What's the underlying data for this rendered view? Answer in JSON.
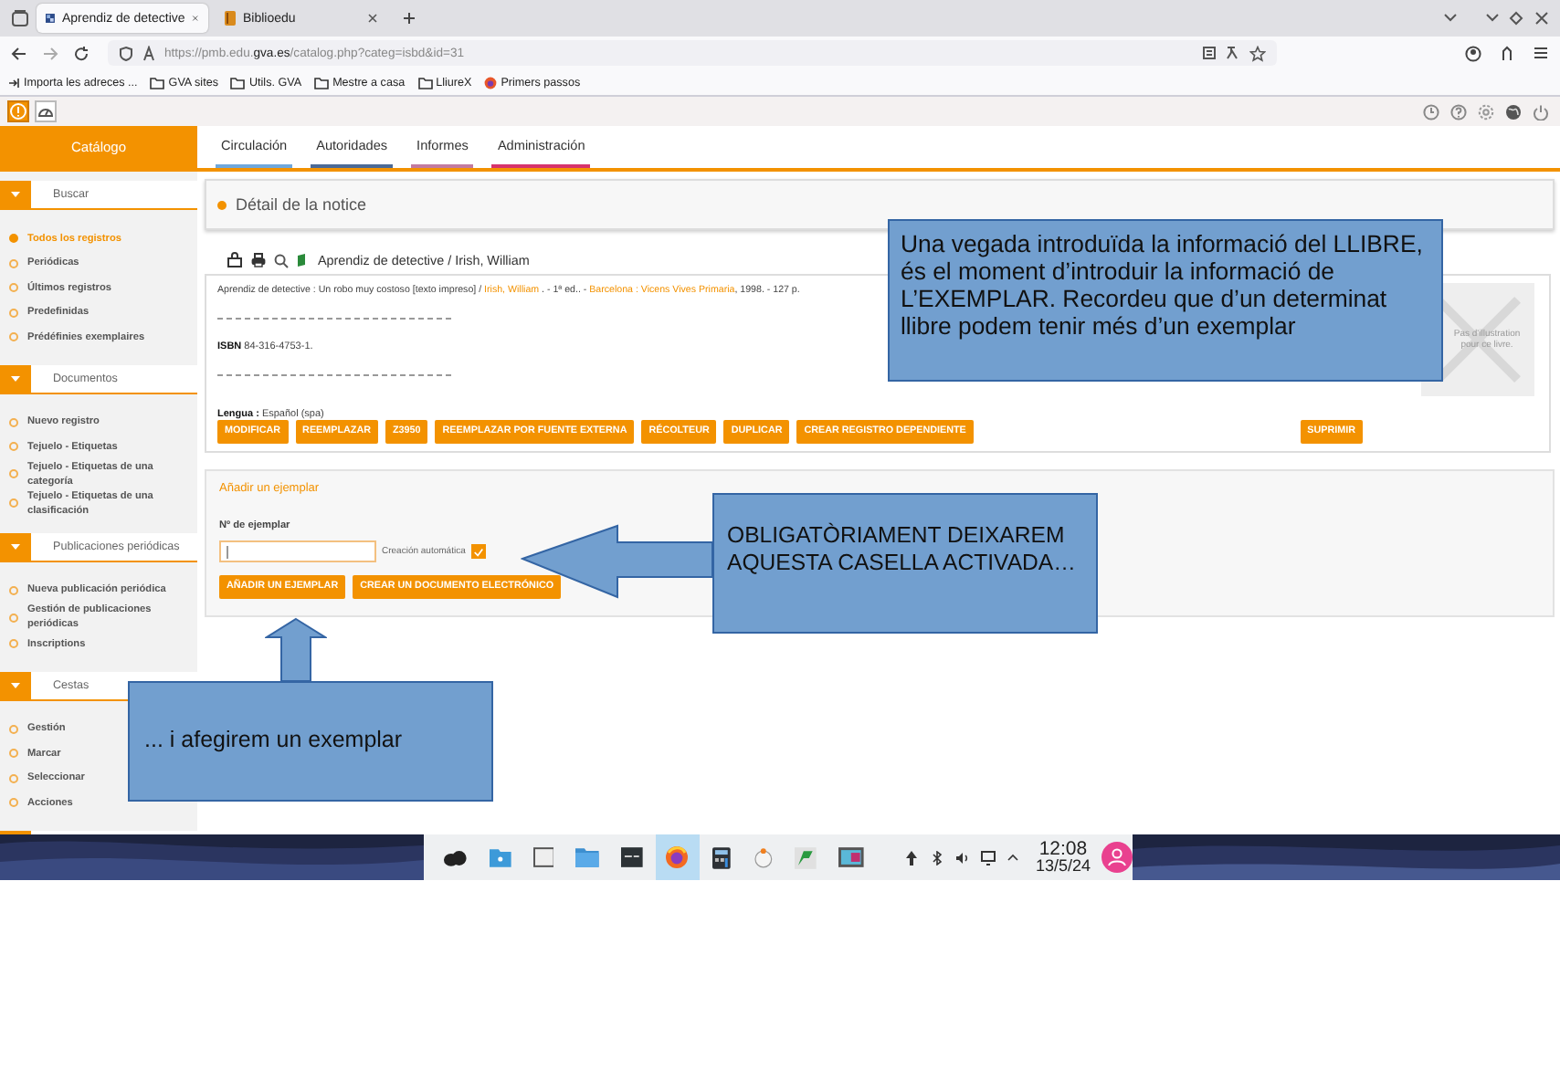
{
  "browser": {
    "tabs": [
      {
        "title": "Aprendiz de detective",
        "selected": true,
        "kind": "pmb"
      },
      {
        "title": "Biblioedu",
        "selected": false,
        "kind": "book"
      }
    ],
    "url": "https://pmb.edu.**gva.es**/catalog.php?categ=isbd&id=31",
    "bookmarks": [
      {
        "label": "Importa les adreces ...",
        "kind": "import"
      },
      {
        "label": "GVA sites",
        "kind": "folder"
      },
      {
        "label": "Utils. GVA",
        "kind": "folder"
      },
      {
        "label": "Mestre a casa",
        "kind": "folder"
      },
      {
        "label": "LliureX",
        "kind": "folder"
      },
      {
        "label": "Primers passos",
        "kind": "firefox"
      }
    ]
  },
  "app_toolbar": {
    "mode_buttons": [
      {
        "kind": "info",
        "selected": true
      },
      {
        "kind": "dashboard",
        "selected": false
      }
    ]
  },
  "module": "Catálogo",
  "nav_tabs": [
    {
      "label": "Circulación",
      "color": "#6fa8dc"
    },
    {
      "label": "Autoridades",
      "color": "#4b6a96"
    },
    {
      "label": "Informes",
      "color": "#c27ba0"
    },
    {
      "label": "Administración",
      "color": "#d6336c"
    }
  ],
  "sidebar": [
    {
      "title": "Buscar",
      "items": [
        {
          "label": "Todos los registros",
          "selected": true
        },
        {
          "label": "Periódicas",
          "selected": false
        },
        {
          "label": "Últimos registros",
          "selected": false
        },
        {
          "label": "Predefinidas",
          "selected": false
        },
        {
          "label": "Prédéfinies exemplaires",
          "selected": false
        }
      ]
    },
    {
      "title": "Documentos",
      "items": [
        {
          "label": "Nuevo registro",
          "selected": false
        },
        {
          "label": "Tejuelo - Etiquetas",
          "selected": false
        },
        {
          "label": "Tejuelo - Etiquetas de una categoría",
          "selected": false
        },
        {
          "label": "Tejuelo - Etiquetas de una clasificación",
          "selected": false
        }
      ]
    },
    {
      "title": "Publicaciones periódicas",
      "items": [
        {
          "label": "Nueva publicación periódica",
          "selected": false
        },
        {
          "label": "Gestión de publicaciones periódicas",
          "selected": false
        },
        {
          "label": "Inscriptions",
          "selected": false
        }
      ]
    },
    {
      "title": "Cestas",
      "items": [
        {
          "label": "Gestión",
          "selected": false
        },
        {
          "label": "Marcar",
          "selected": false
        },
        {
          "label": "Seleccionar",
          "selected": false
        },
        {
          "label": "Acciones",
          "selected": false
        }
      ]
    }
  ],
  "panel_title": "Détail de la notice",
  "record": {
    "heading": "Aprendiz de detective / Irish, William",
    "description": [
      {
        "text": "Aprendiz de detective : Un robo muy costoso [texto impreso] / ",
        "link": false
      },
      {
        "text": "Irish, William",
        "link": true
      },
      {
        "text": " . - 1ª ed.. - ",
        "link": false
      },
      {
        "text": "Barcelona : Vicens Vives Primaria",
        "link": true
      },
      {
        "text": ", 1998. - 127 p.",
        "link": false
      }
    ],
    "isbn": "**ISBN** 84-316-4753-1.",
    "language": "**Lengua :** Español (spa)",
    "no_image": "Pas d'illustration pour ce livre.",
    "buttons": [
      "MODIFICAR",
      "REEMPLAZAR",
      "Z3950",
      "REEMPLAZAR POR FUENTE EXTERNA",
      "RÉCOLTEUR",
      "DUPLICAR",
      "CREAR REGISTRO DEPENDIENTE"
    ],
    "delete_button": "SUPRIMIR"
  },
  "exemplar": {
    "title": "Añadir un ejemplar",
    "field_label": "Nº de ejemplar",
    "auto_label": "Creación automática",
    "auto_checked": true,
    "buttons": [
      "AÑADIR UN EJEMPLAR",
      "CREAR UN DOCUMENTO ELECTRÓNICO"
    ]
  },
  "callouts": [
    {
      "text": "Una vegada introduïda la informació del LLIBRE, és el moment d’introduir la informació de L’EXEMPLAR. Recordeu que d’un determinat llibre podem tenir més d’un exemplar",
      "kind": "plain"
    },
    {
      "text": "OBLIGATÒRIAMENT DEIXAREM AQUESTA CASELLA ACTIVADA…",
      "kind": "left-arrow"
    },
    {
      "text": "... i afegirem un exemplar",
      "kind": "up-arrow"
    }
  ],
  "taskbar": {
    "time": "12:08",
    "date": "13/5/24"
  }
}
